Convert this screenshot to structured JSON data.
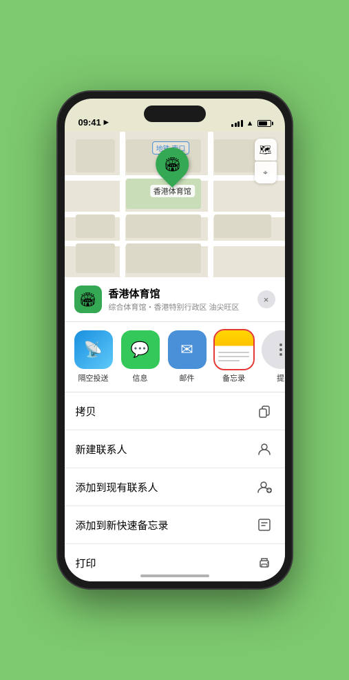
{
  "status_bar": {
    "time": "09:41",
    "location_arrow": "▶"
  },
  "map": {
    "label": "南口",
    "label_prefix": "地铁"
  },
  "venue": {
    "name": "香港体育馆",
    "description": "综合体育馆・香港特别行政区 油尖旺区",
    "pin_label": "香港体育馆",
    "icon": "🏟"
  },
  "share_items": [
    {
      "id": "airdrop",
      "label": "隔空投送",
      "icon": "📡"
    },
    {
      "id": "message",
      "label": "信息",
      "icon": "💬"
    },
    {
      "id": "mail",
      "label": "邮件",
      "icon": "✉"
    },
    {
      "id": "notes",
      "label": "备忘录",
      "icon": ""
    },
    {
      "id": "more",
      "label": "提",
      "icon": ""
    }
  ],
  "actions": [
    {
      "id": "copy",
      "label": "拷贝",
      "icon": "⎘"
    },
    {
      "id": "new-contact",
      "label": "新建联系人",
      "icon": "👤"
    },
    {
      "id": "add-existing",
      "label": "添加到现有联系人",
      "icon": "👤+"
    },
    {
      "id": "add-notes",
      "label": "添加到新快速备忘录",
      "icon": "📝"
    },
    {
      "id": "print",
      "label": "打印",
      "icon": "🖨"
    }
  ],
  "close_label": "×",
  "map_controls": {
    "map_icon": "🗺",
    "location_icon": "⌖"
  }
}
